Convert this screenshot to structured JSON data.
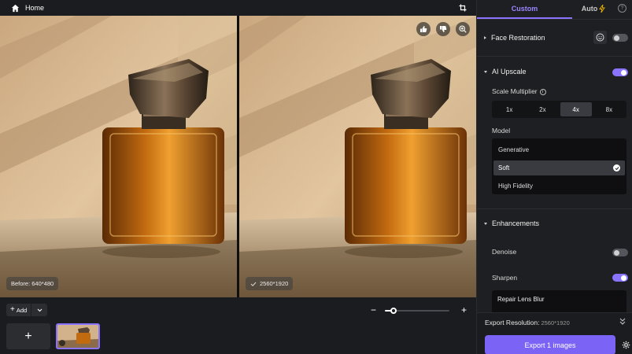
{
  "topbar": {
    "home_label": "Home"
  },
  "images": {
    "before_badge": "Before: 640*480",
    "after_badge": "2560*1920"
  },
  "bottom": {
    "add_label": "Add",
    "zoom_level": 0.14
  },
  "panel": {
    "tabs": {
      "custom": "Custom",
      "auto": "Auto"
    },
    "face_restoration": {
      "label": "Face Restoration",
      "enabled": false
    },
    "ai_upscale": {
      "label": "AI Upscale",
      "enabled": true,
      "scale_label": "Scale Multiplier",
      "scales": [
        "1x",
        "2x",
        "4x",
        "8x"
      ],
      "selected_scale": "4x",
      "model_label": "Model",
      "models": [
        "Generative",
        "Soft",
        "High Fidelity"
      ],
      "selected_model": "Soft"
    },
    "enhancements": {
      "label": "Enhancements",
      "denoise_label": "Denoise",
      "denoise_enabled": false,
      "sharpen_label": "Sharpen",
      "sharpen_enabled": true,
      "repair_label": "Repair Lens Blur"
    },
    "footer": {
      "export_resolution_label": "Export Resolution:",
      "export_resolution_value": "2560*1920",
      "export_button": "Export 1 images"
    }
  },
  "colors": {
    "accent": "#8a74ff",
    "export": "#7a63f5"
  }
}
